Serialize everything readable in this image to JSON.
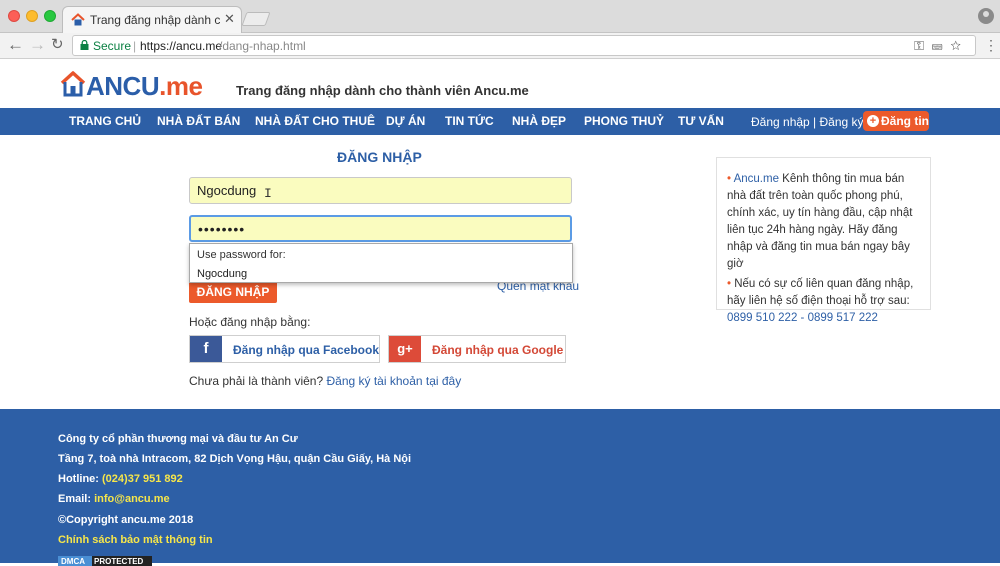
{
  "browser": {
    "tab_title": "Trang đăng nhập dành cho thà",
    "secure_label": "Secure",
    "url_host": "https://ancu.me",
    "url_path": "/dang-nhap.html"
  },
  "header": {
    "logo_main": "ANCU",
    "logo_suffix": ".me",
    "title": "Trang đăng nhập dành cho thành viên Ancu.me"
  },
  "nav": {
    "items": [
      "TRANG CHỦ",
      "NHÀ ĐẤT BÁN",
      "NHÀ ĐẤT CHO THUÊ",
      "DỰ ÁN",
      "TIN TỨC",
      "NHÀ ĐẸP",
      "PHONG THUỶ",
      "TƯ VẤN"
    ],
    "login_link": "Đăng nhập | Đăng ký",
    "post_button": "Đăng tin"
  },
  "login": {
    "title": "ĐĂNG NHẬP",
    "username_value": "Ngocdung",
    "password_value": "••••••••",
    "autofill_header": "Use password for:",
    "autofill_item": "Ngocdung",
    "submit_label": "ĐĂNG NHẬP",
    "forgot_label": "Quên mật khẩu",
    "or_login_label": "Hoặc đăng nhập bằng:",
    "facebook_label": "Đăng nhập qua Facebook",
    "google_label": "Đăng nhập qua Google",
    "signup_prompt": "Chưa phải là thành viên?",
    "signup_link": "Đăng ký tài khoản tại đây"
  },
  "info": {
    "brand": "Ancu.me",
    "p1_text": " Kênh thông tin mua bán nhà đất trên toàn quốc phong phú, chính xác, uy tín hàng đầu, cập nhật liên tục 24h hàng ngày. Hãy đăng nhập và đăng tin mua bán ngay bây giờ",
    "p2_text": "Nếu có sự cố liên quan đăng nhập, hãy liên hệ số điện thoại hỗ trợ sau:",
    "phones": "0899 510 222 - 0899 517 222"
  },
  "footer": {
    "company": "Công ty cổ phần thương mại và đầu tư An Cư",
    "address": "Tầng 7, toà nhà Intracom, 82 Dịch Vọng Hậu, quận Cầu Giấy, Hà Nội",
    "hotline_label": "Hotline:",
    "hotline_value": "(024)37 951 892",
    "email_label": "Email:",
    "email_value": "info@ancu.me",
    "copyright": "©Copyright ancu.me 2018",
    "privacy": "Chính sách bảo mật thông tin",
    "dmca_1": "DMCA",
    "dmca_2": "PROTECTED"
  }
}
